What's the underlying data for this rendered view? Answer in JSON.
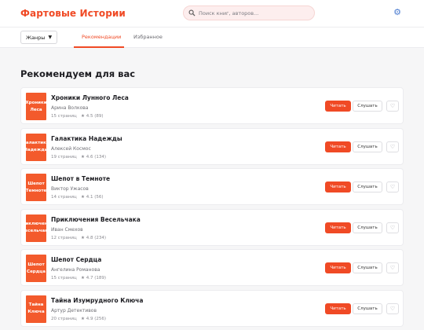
{
  "header": {
    "logo": "Фартовые Истории",
    "search_placeholder": "Поиск книг, авторов...",
    "settings_icon": "gear-icon"
  },
  "subnav": {
    "genres_label": "Жанры",
    "tabs": [
      {
        "label": "Рекомендации",
        "active": true
      },
      {
        "label": "Избранное",
        "active": false
      }
    ]
  },
  "section_title": "Рекомендуем для вас",
  "actions": {
    "read": "Читать",
    "listen": "Слушать"
  },
  "accent_color": "#f04a25",
  "books": [
    {
      "title": "Хроники Лунного Леса",
      "cover": "Хроники\nЛеса",
      "author": "Арина Волкова",
      "pages": "15 страниц",
      "rating": "★ 4.5 (89)"
    },
    {
      "title": "Галактика Надежды",
      "cover": "Галактика\nНадежды",
      "author": "Алексей Космос",
      "pages": "19 страниц",
      "rating": "★ 4.6 (134)"
    },
    {
      "title": "Шепот в Темноте",
      "cover": "Шепот\nТемноте",
      "author": "Виктор Ужасов",
      "pages": "14 страниц",
      "rating": "★ 4.1 (56)"
    },
    {
      "title": "Приключения Весельчака",
      "cover": "Приключения\nВесельчака",
      "author": "Иван Смехов",
      "pages": "12 страниц",
      "rating": "★ 4.8 (234)"
    },
    {
      "title": "Шепот Сердца",
      "cover": "Шепот\nСердца",
      "author": "Ангелина Романова",
      "pages": "15 страниц",
      "rating": "★ 4.7 (189)"
    },
    {
      "title": "Тайна Изумрудного Ключа",
      "cover": "Тайна\nКлюча",
      "author": "Артур Детективов",
      "pages": "20 страниц",
      "rating": "★ 4.9 (256)"
    }
  ]
}
